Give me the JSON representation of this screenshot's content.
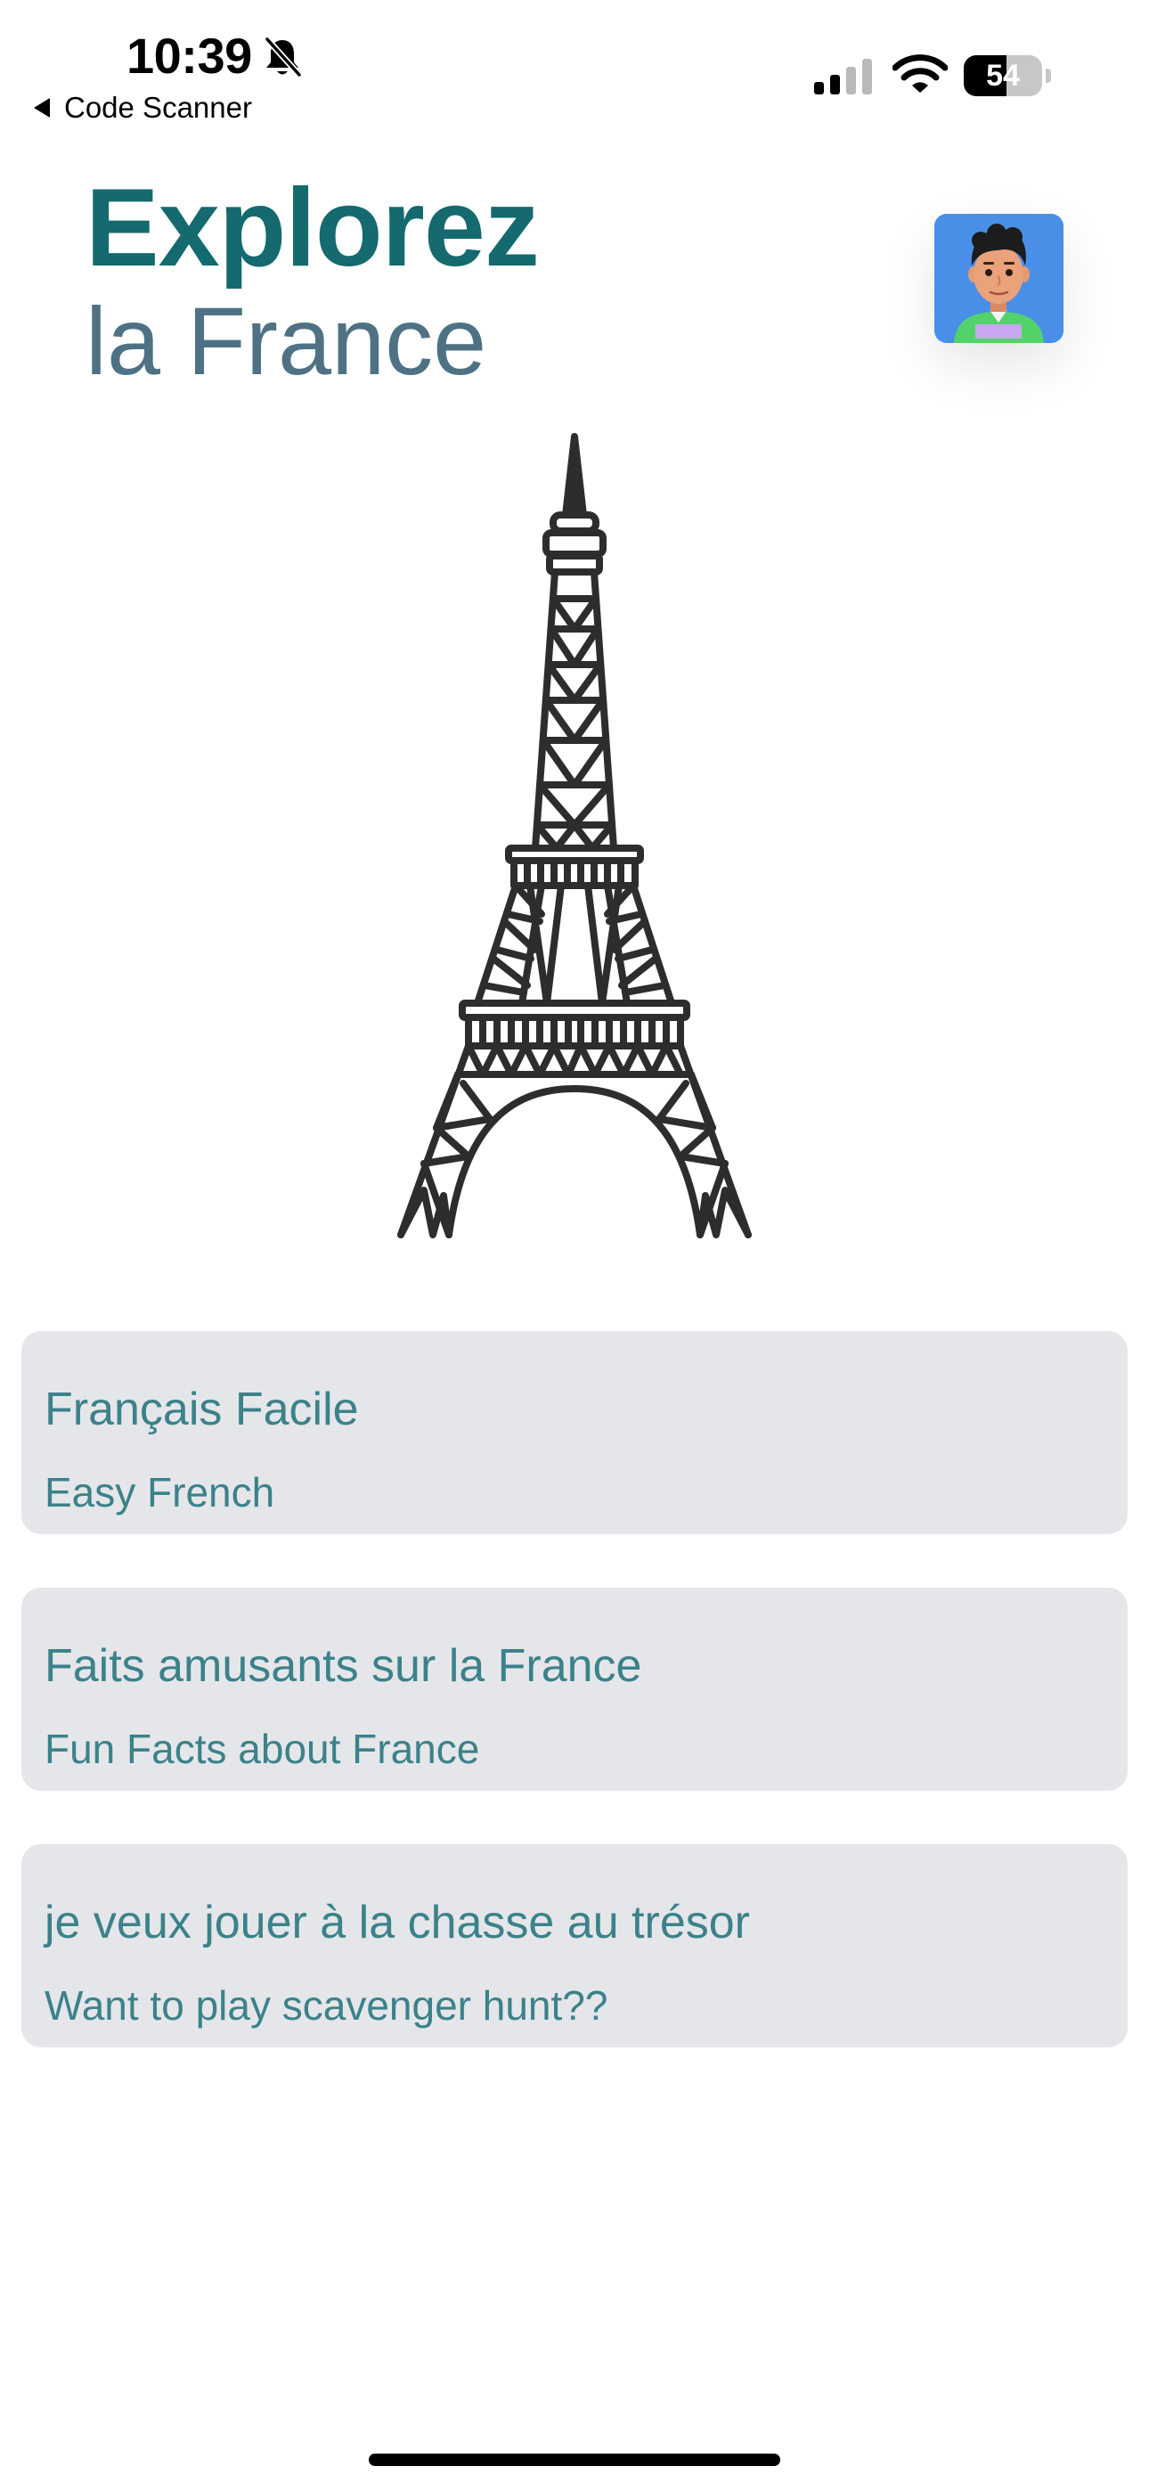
{
  "status_bar": {
    "time": "10:39",
    "back_label": "Code Scanner",
    "battery_level": "54",
    "battery_fraction": 0.54,
    "icons": [
      "bell-slash-icon",
      "cellular-signal-icon",
      "wifi-icon",
      "battery-icon"
    ]
  },
  "header": {
    "title": "Explorez",
    "subtitle": "la France",
    "avatar_icon": "memoji-avatar-icon"
  },
  "illustration": {
    "icon": "eiffel-tower-icon"
  },
  "cards": [
    {
      "title": "Français Facile",
      "subtitle": "Easy French"
    },
    {
      "title": "Faits amusants sur la France",
      "subtitle": "Fun Facts about France"
    },
    {
      "title": "je veux jouer à la chasse au trésor",
      "subtitle": "Want to play scavenger hunt??"
    }
  ],
  "colors": {
    "title": "#146a6e",
    "subtitle": "#4f7184",
    "card_background": "#e5e6ea",
    "card_text": "#3b8289",
    "avatar_background": "#4a8fe7"
  }
}
